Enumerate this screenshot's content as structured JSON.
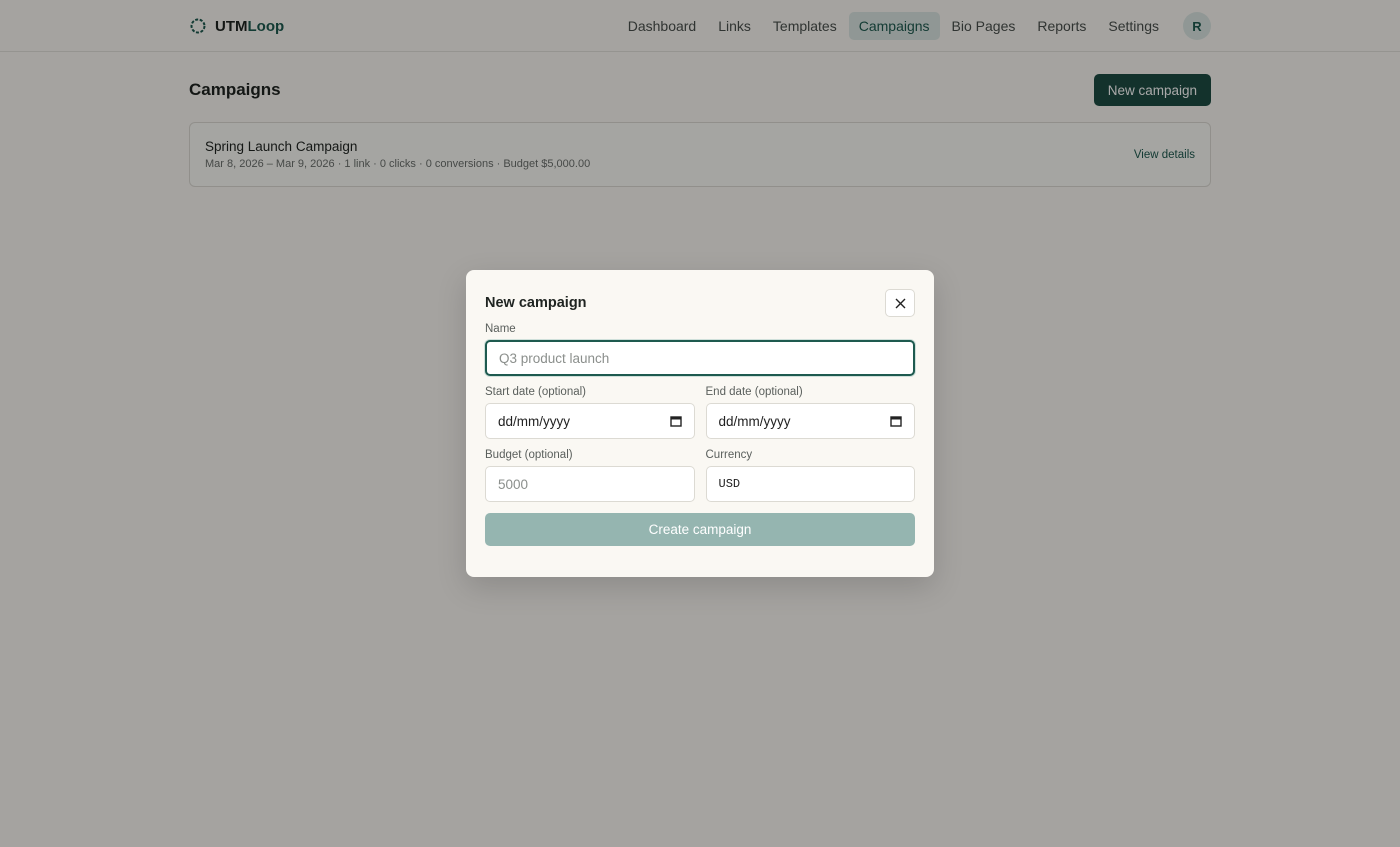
{
  "brand": {
    "name_main": "UTM",
    "name_accent": "Loop"
  },
  "nav": {
    "items": [
      "Dashboard",
      "Links",
      "Templates",
      "Campaigns",
      "Bio Pages",
      "Reports",
      "Settings"
    ],
    "active": "Campaigns",
    "avatar_initial": "R"
  },
  "page": {
    "title": "Campaigns",
    "new_button": "New campaign"
  },
  "campaigns": [
    {
      "name": "Spring Launch Campaign",
      "meta": "Mar 8, 2026 – Mar 9, 2026 · 1 link · 0 clicks · 0 conversions · Budget $5,000.00",
      "link": "View details"
    }
  ],
  "modal": {
    "title": "New campaign",
    "name_label": "Name",
    "name_placeholder": "Q3 product launch",
    "start_label": "Start date (optional)",
    "start_value": "dd/mm/yyyy",
    "end_label": "End date (optional)",
    "end_value": "dd/mm/yyyy",
    "budget_label": "Budget (optional)",
    "budget_placeholder": "5000",
    "currency_label": "Currency",
    "currency_value": "USD",
    "submit": "Create campaign"
  },
  "colors": {
    "accent": "#1e4d44",
    "accent_light": "#dbe6e2",
    "disabled_button": "#95b5b0"
  },
  "icons": {
    "logo": "ring-logo-icon",
    "close": "close-icon",
    "calendar": "calendar-icon"
  }
}
